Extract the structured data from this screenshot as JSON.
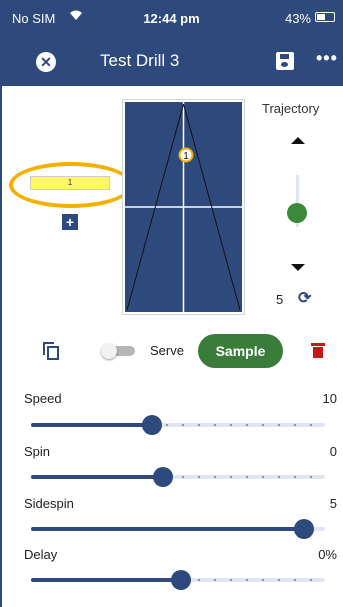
{
  "status_bar": {
    "carrier": "No SIM",
    "time": "12:44 pm",
    "battery": "43%"
  },
  "app_bar": {
    "title": "Test Drill 3",
    "more_label": "•••"
  },
  "zone": {
    "label": "1",
    "add_label": "+"
  },
  "table": {
    "marker_label": "1"
  },
  "trajectory": {
    "label": "Trajectory",
    "value": "5",
    "level": 0.3
  },
  "controls": {
    "serve_label": "Serve",
    "serve_on": false,
    "sample_label": "Sample"
  },
  "sliders": [
    {
      "label": "Speed",
      "value": "10",
      "fraction": 0.41
    },
    {
      "label": "Spin",
      "value": "0",
      "fraction": 0.45
    },
    {
      "label": "Sidespin",
      "value": "5",
      "fraction": 0.93
    },
    {
      "label": "Delay",
      "value": "0%",
      "fraction": 0.51
    }
  ],
  "colors": {
    "primary": "#2e4a7d",
    "accent_green": "#3a7d3a",
    "highlight": "#f4b000",
    "zone_fill": "#fff76a",
    "danger": "#c41919"
  }
}
